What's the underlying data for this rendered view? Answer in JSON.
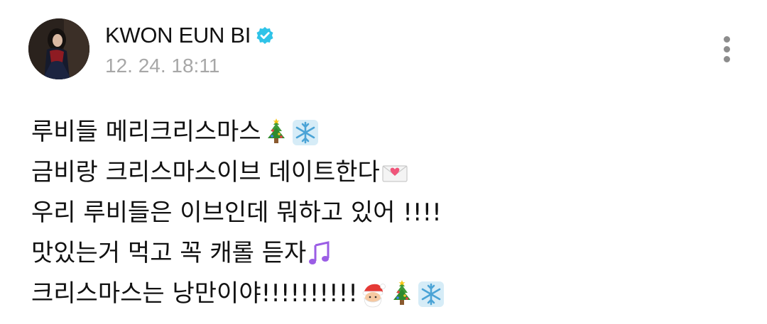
{
  "author": {
    "name": "KWON EUN BI",
    "verified_color": "#2fc3e8"
  },
  "timestamp": "12. 24. 18:11",
  "menu": {
    "icon": "more-vertical-icon"
  },
  "post": {
    "lines": [
      {
        "text": "루비들 메리크리스마스",
        "emojis": [
          "christmas-tree-icon",
          "snowflake-icon"
        ]
      },
      {
        "text": "금비랑 크리스마스이브 데이트한다",
        "emojis": [
          "love-letter-icon"
        ]
      },
      {
        "text": "우리 루비들은 이브인데 뭐하고 있어 !!!!",
        "emojis": []
      },
      {
        "text": "맛있는거 먹고 꼭 캐롤 듣자",
        "emojis": [
          "musical-notes-icon"
        ]
      },
      {
        "text": "크리스마스는 낭만이야!!!!!!!!!!",
        "emojis": [
          "santa-icon",
          "christmas-tree-icon",
          "snowflake-icon"
        ]
      }
    ]
  }
}
